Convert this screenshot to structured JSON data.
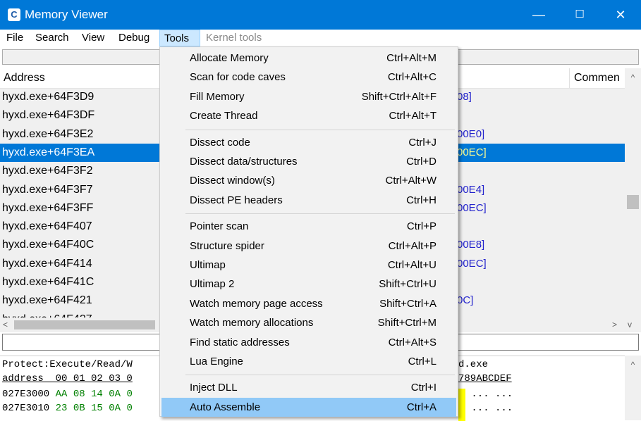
{
  "window": {
    "title": "Memory Viewer",
    "min": "—",
    "max": "☐",
    "close": "✕"
  },
  "menubar": [
    "File",
    "Search",
    "View",
    "Debug",
    "Tools",
    "Kernel tools"
  ],
  "disasm": {
    "header_address": "Address",
    "header_comment": "Commen",
    "rows": [
      {
        "addr": "hyxd.exe+64F3D9",
        "frag": "08]"
      },
      {
        "addr": "hyxd.exe+64F3DF",
        "frag": ""
      },
      {
        "addr": "hyxd.exe+64F3E2",
        "frag": "00E0]"
      },
      {
        "addr": "hyxd.exe+64F3EA",
        "frag": "00EC]"
      },
      {
        "addr": "hyxd.exe+64F3F2",
        "frag": ""
      },
      {
        "addr": "hyxd.exe+64F3F7",
        "frag": "00E4]"
      },
      {
        "addr": "hyxd.exe+64F3FF",
        "frag": "00EC]"
      },
      {
        "addr": "hyxd.exe+64F407",
        "frag": ""
      },
      {
        "addr": "hyxd.exe+64F40C",
        "frag": "00E8]"
      },
      {
        "addr": "hyxd.exe+64F414",
        "frag": "00EC]"
      },
      {
        "addr": "hyxd.exe+64F41C",
        "frag": ""
      },
      {
        "addr": "hyxd.exe+64F421",
        "frag": "0C]"
      }
    ],
    "partial_row": "hyxd.exe+64F427",
    "selected_index": 3
  },
  "hexview": {
    "protect_line": "Protect:Execute/Read/W",
    "protect_right": "d.exe",
    "header_left": "address  00 01 02 03 0",
    "header_right": "789ABCDEF",
    "rows": [
      {
        "addr": "027E3000",
        "bytes": "AA 08 14 0A 0",
        "right": " ... ..."
      },
      {
        "addr": "027E3010",
        "bytes": "23 0B 15 0A 0",
        "right": " ... ..."
      }
    ]
  },
  "tools_menu": {
    "groups": [
      [
        {
          "label": "Allocate Memory",
          "shortcut": "Ctrl+Alt+M"
        },
        {
          "label": "Scan for code caves",
          "shortcut": "Ctrl+Alt+C"
        },
        {
          "label": "Fill Memory",
          "shortcut": "Shift+Ctrl+Alt+F"
        },
        {
          "label": "Create Thread",
          "shortcut": "Ctrl+Alt+T"
        }
      ],
      [
        {
          "label": "Dissect code",
          "shortcut": "Ctrl+J"
        },
        {
          "label": "Dissect data/structures",
          "shortcut": "Ctrl+D"
        },
        {
          "label": "Dissect window(s)",
          "shortcut": "Ctrl+Alt+W"
        },
        {
          "label": "Dissect PE headers",
          "shortcut": "Ctrl+H"
        }
      ],
      [
        {
          "label": "Pointer scan",
          "shortcut": "Ctrl+P"
        },
        {
          "label": "Structure spider",
          "shortcut": "Ctrl+Alt+P"
        },
        {
          "label": "Ultimap",
          "shortcut": "Ctrl+Alt+U"
        },
        {
          "label": "Ultimap 2",
          "shortcut": "Shift+Ctrl+U"
        },
        {
          "label": "Watch memory page access",
          "shortcut": "Shift+Ctrl+A"
        },
        {
          "label": "Watch memory allocations",
          "shortcut": "Shift+Ctrl+M"
        },
        {
          "label": "Find static addresses",
          "shortcut": "Ctrl+Alt+S"
        },
        {
          "label": "Lua Engine",
          "shortcut": "Ctrl+L"
        }
      ],
      [
        {
          "label": "Inject DLL",
          "shortcut": "Ctrl+I"
        },
        {
          "label": "Auto Assemble",
          "shortcut": "Ctrl+A"
        }
      ]
    ],
    "highlighted_label": "Auto Assemble"
  },
  "icons": {
    "app": "cheat-engine-icon",
    "scroll_up": "▲",
    "scroll_left": "<",
    "scroll_right": ">",
    "scroll_down": "v",
    "caret_up": "^"
  },
  "colors": {
    "title_bar": "#0078d7",
    "selection": "#0078d7",
    "menu_highlight": "#91c9f7",
    "hex_bytes": "#008000",
    "comment": "#2222cc"
  }
}
